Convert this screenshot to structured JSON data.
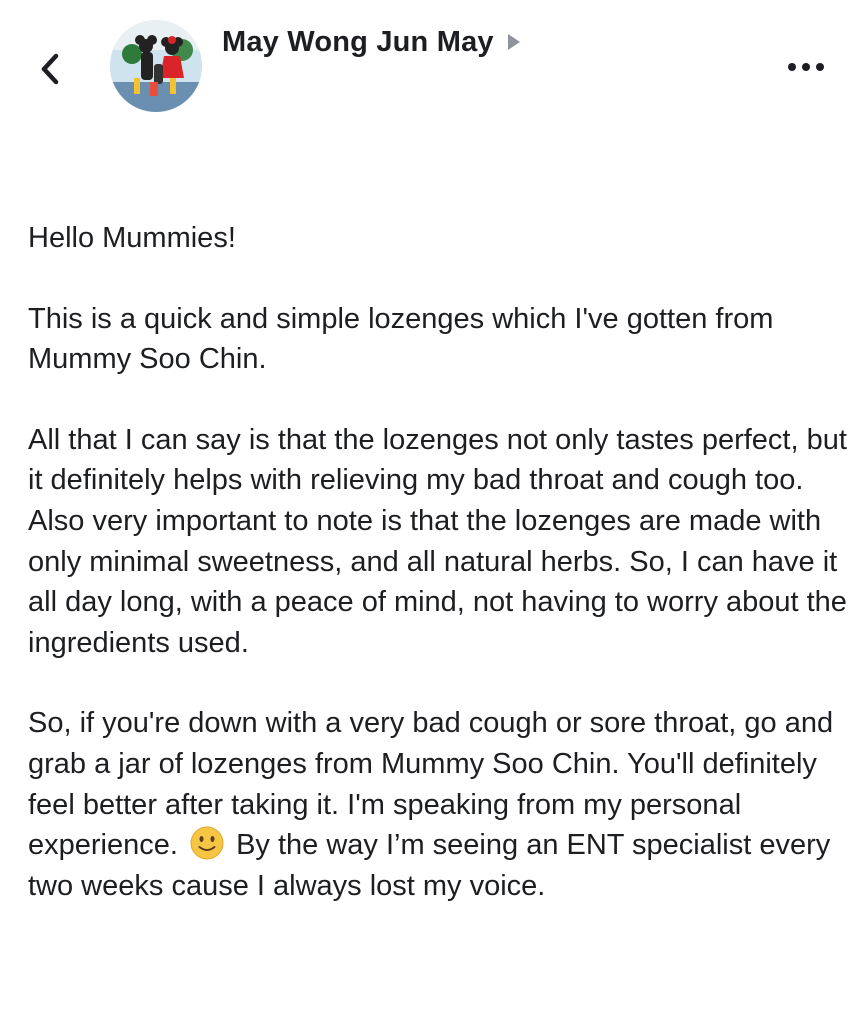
{
  "header": {
    "back_icon": "chevron-left-icon",
    "avatar_icon": "profile-photo",
    "author_name": "May Wong Jun May",
    "audience_icon": "triangle-right-icon",
    "more_icon": "more-dots-icon"
  },
  "post": {
    "greeting": "Hello Mummies!",
    "paragraph_1": "This is a quick and simple lozenges which I've gotten from Mummy Soo Chin.",
    "paragraph_2": "All that I can say is that the lozenges not only tastes perfect, but it definitely helps with relieving my bad throat and cough too. Also very important to note is that the lozenges are made with only minimal sweetness, and all natural herbs. So, I can have it all day long, with a peace of mind, not having to worry about the ingredients used.",
    "paragraph_3_before_emoji": "So, if you're down with a very bad cough or sore throat, go and grab a jar of lozenges from Mummy Soo Chin. You'll definitely feel better after taking it. I'm speaking from my personal experience.",
    "emoji_icon": "slightly-smiling-face-icon",
    "paragraph_3_after_emoji": "By the way I’m seeing an ENT specialist every two weeks cause I always lost my voice."
  },
  "colors": {
    "text": "#1c1e21",
    "icon_gray": "#606770",
    "emoji_yellow": "#f7c544"
  }
}
